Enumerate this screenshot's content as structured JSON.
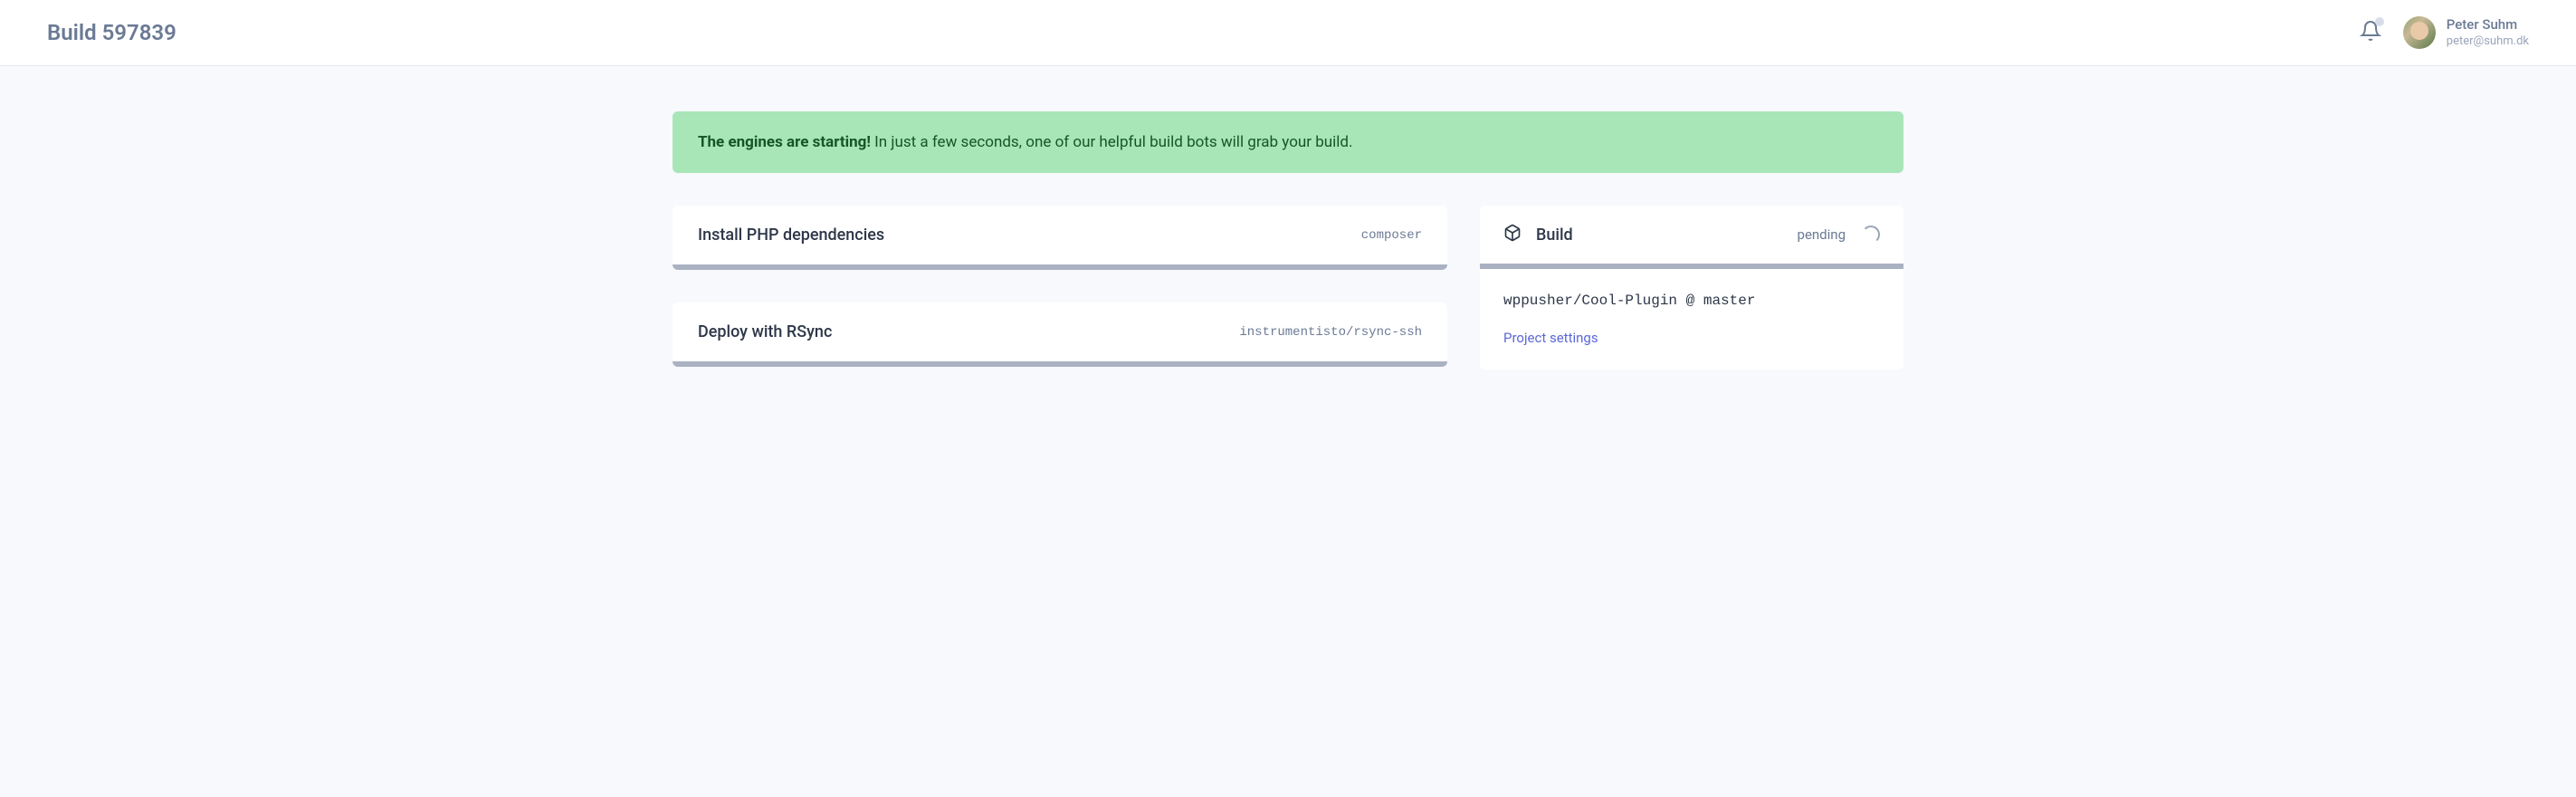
{
  "header": {
    "title": "Build 597839",
    "user": {
      "name": "Peter Suhm",
      "email": "peter@suhm.dk"
    }
  },
  "banner": {
    "strong": "The engines are starting!",
    "rest": " In just a few seconds, one of our helpful build bots will grab your build."
  },
  "steps": [
    {
      "title": "Install PHP dependencies",
      "tag": "composer"
    },
    {
      "title": "Deploy with RSync",
      "tag": "instrumentisto/rsync-ssh"
    }
  ],
  "build": {
    "title": "Build",
    "status": "pending",
    "repo": "wppusher/Cool-Plugin @ master",
    "settings_link": "Project settings"
  }
}
